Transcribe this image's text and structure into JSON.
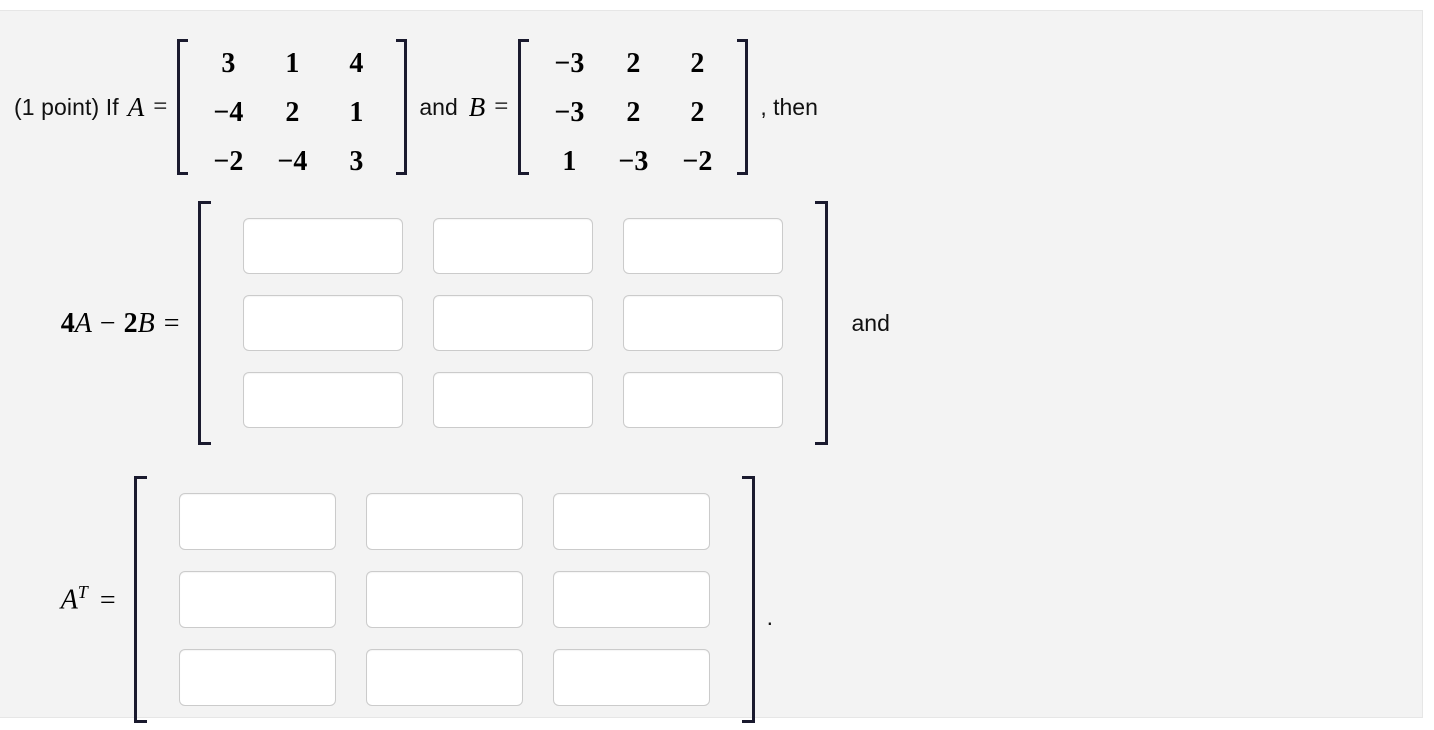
{
  "problem": {
    "intro_text": "(1 point) If",
    "var_a_label": "A",
    "equals_sign": "=",
    "connector_and": "and",
    "var_b_label": "B",
    "connector_then": ", then",
    "matrix_a": {
      "name": "A",
      "rows": [
        [
          "3",
          "1",
          "4"
        ],
        [
          "−4",
          "2",
          "1"
        ],
        [
          "−2",
          "−4",
          "3"
        ]
      ]
    },
    "matrix_b": {
      "name": "B",
      "rows": [
        [
          "−3",
          "2",
          "2"
        ],
        [
          "−3",
          "2",
          "2"
        ],
        [
          "1",
          "−3",
          "−2"
        ]
      ]
    }
  },
  "answers": {
    "expression_1": {
      "label_prefix": "4",
      "label_a": "A",
      "label_minus": "−",
      "label_two": "2",
      "label_b": "B",
      "label_equals": "=",
      "label_full": "4A − 2B =",
      "trailing": "and",
      "values": [
        [
          "",
          "",
          ""
        ],
        [
          "",
          "",
          ""
        ],
        [
          "",
          "",
          ""
        ]
      ],
      "placeholder": ""
    },
    "expression_2": {
      "label_a": "A",
      "label_superscript": "T",
      "label_equals": "=",
      "label_full": "Aᵀ =",
      "trailing": ".",
      "values": [
        [
          "",
          "",
          ""
        ],
        [
          "",
          "",
          ""
        ],
        [
          "",
          "",
          ""
        ]
      ],
      "placeholder": ""
    }
  },
  "colors": {
    "page_background": "#ffffff",
    "panel_background": "#f3f3f3",
    "panel_border": "#e6e6e6",
    "text": "#111111",
    "bracket": "#1a1a2e",
    "input_border": "#cbcbcb",
    "input_background": "#ffffff"
  }
}
